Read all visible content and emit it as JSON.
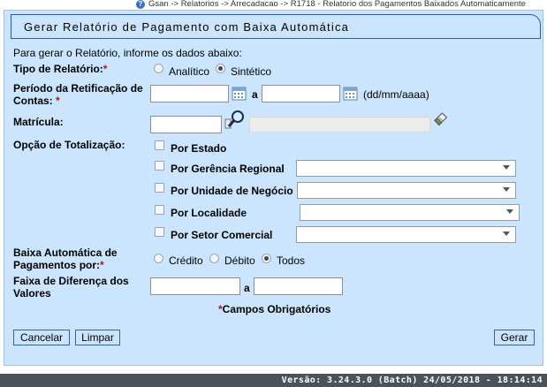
{
  "breadcrumb": {
    "help_glyph": "?",
    "path": "Gsan -> Relatorios -> Arrecadacao -> R1718 - Relatorio dos Pagamentos Baixados Automaticamente"
  },
  "form": {
    "title": "Gerar Relatório de Pagamento com Baixa Automática",
    "intro": "Para gerar o Relatório, informe os dados abaixo:",
    "tipo_relatorio": {
      "label": "Tipo de Relatório:",
      "required": "*",
      "options": [
        "Analítico",
        "Sintético"
      ],
      "selected": "Sintético"
    },
    "periodo": {
      "label_line1": "Período da Retificação de",
      "label_line2": "Contas:",
      "required": "*",
      "separator": "a",
      "format_hint": "(dd/mm/aaaa)",
      "start_value": "",
      "end_value": ""
    },
    "matricula": {
      "label": "Matrícula:",
      "value": "",
      "description": ""
    },
    "totalizacao": {
      "label": "Opção de Totalização:",
      "options": [
        {
          "label": "Por Estado",
          "checked": false,
          "has_select": false
        },
        {
          "label": "Por Gerência Regional",
          "checked": false,
          "has_select": true,
          "select_value": ""
        },
        {
          "label": "Por Unidade de Negócio",
          "checked": false,
          "has_select": true,
          "select_value": ""
        },
        {
          "label": "Por Localidade",
          "checked": false,
          "has_select": true,
          "select_value": ""
        },
        {
          "label": "Por Setor Comercial",
          "checked": false,
          "has_select": true,
          "select_value": ""
        }
      ]
    },
    "baixa": {
      "label_line1": "Baixa Automática de",
      "label_line2": "Pagamentos por:",
      "required": "*",
      "options": [
        "Crédito",
        "Débito",
        "Todos"
      ],
      "selected": "Todos"
    },
    "faixa": {
      "label_line1": "Faixa de Diferença dos",
      "label_line2": "Valores",
      "separator": "a",
      "min_value": "",
      "max_value": ""
    },
    "required_note_star": "*",
    "required_note": "Campos Obrigatórios",
    "buttons": {
      "cancel": "Cancelar",
      "clear": "Limpar",
      "generate": "Gerar"
    }
  },
  "footer": {
    "version": "Versão: 3.24.3.0 (Batch) 24/05/2018 - 18:14:14"
  },
  "colors": {
    "panel_bg": "#cbe5fe",
    "title_border": "#2c58a8",
    "required": "#e00000",
    "footer_bg": "#4a535b"
  }
}
